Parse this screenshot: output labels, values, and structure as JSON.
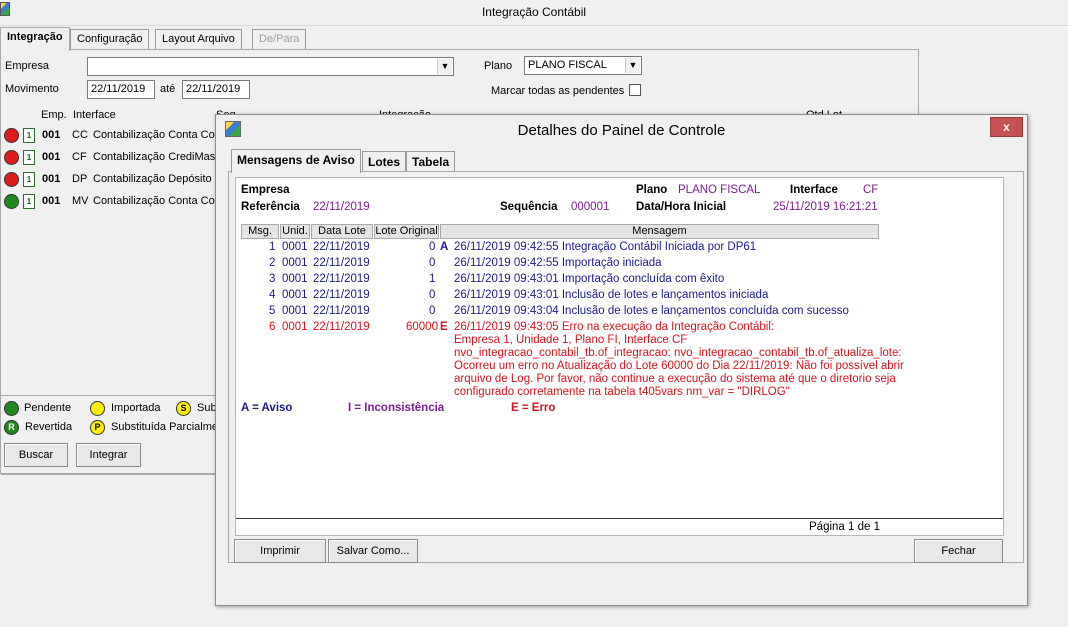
{
  "window": {
    "title": "Integração Contábil"
  },
  "tabs": [
    {
      "label": "Integração"
    },
    {
      "label": "Configuração"
    },
    {
      "label": "Layout Arquivo"
    },
    {
      "label": "De/Para"
    }
  ],
  "filters": {
    "empresa_label": "Empresa",
    "empresa_value": "",
    "movimento_label": "Movimento",
    "movimento_from": "22/11/2019",
    "ate_label": "até",
    "movimento_to": "22/11/2019",
    "plano_label": "Plano",
    "plano_value": "PLANO FISCAL",
    "marcar_label": "Marcar todas as pendentes"
  },
  "list": {
    "headers": {
      "emp": "Emp.",
      "interface": "Interface",
      "seq": "Seq",
      "integracao": "Integração",
      "qtd": "Qtd.Lot"
    },
    "rows": [
      {
        "status": "red",
        "emp": "001",
        "code": "CC",
        "desc": "Contabilização Conta Co",
        "status_color": "#e11b1b"
      },
      {
        "status": "red",
        "emp": "001",
        "code": "CF",
        "desc": "Contabilização CrediMasl",
        "status_color": "#e11b1b"
      },
      {
        "status": "red",
        "emp": "001",
        "code": "DP",
        "desc": "Contabilização Depósito",
        "status_color": "#e11b1b"
      },
      {
        "status": "green",
        "emp": "001",
        "code": "MV",
        "desc": "Contabilização Conta Co",
        "status_color": "#1e8a1e"
      }
    ]
  },
  "legend": {
    "pendente": "Pendente",
    "importada": "Importada",
    "sub": "Sub",
    "revertida": "Revertida",
    "substituida": "Substituída Parcialme",
    "r_letter": "R",
    "s_letter": "S",
    "p_letter": "P"
  },
  "buttons": {
    "buscar": "Buscar",
    "integrar": "Integrar"
  },
  "dialog": {
    "title": "Detalhes do Painel de Controle",
    "close": "x",
    "tabs": [
      "Mensagens de Aviso",
      "Lotes",
      "Tabela"
    ],
    "report": {
      "empresa_label": "Empresa",
      "referencia_label": "Referência",
      "referencia_value": "22/11/2019",
      "plano_label": "Plano",
      "plano_value": "PLANO FISCAL",
      "interface_label": "Interface",
      "interface_value": "CF",
      "sequencia_label": "Sequência",
      "sequencia_value": "000001",
      "datahora_label": "Data/Hora Inicial",
      "datahora_value": "25/11/2019 16:21:21",
      "columns": [
        "Msg.",
        "Unid.",
        "Data Lote",
        "Lote Original",
        "Mensagem"
      ],
      "messages": [
        {
          "n": "1",
          "unid": "0001",
          "data": "22/11/2019",
          "lote": "0",
          "type": "A",
          "lines": [
            "26/11/2019 09:42:55 Integração Contábil Iniciada por DP61"
          ]
        },
        {
          "n": "2",
          "unid": "0001",
          "data": "22/11/2019",
          "lote": "0",
          "type": "",
          "lines": [
            "26/11/2019 09:42:55 Importação iniciada"
          ]
        },
        {
          "n": "3",
          "unid": "0001",
          "data": "22/11/2019",
          "lote": "1",
          "type": "",
          "lines": [
            "26/11/2019 09:43:01 Importação concluída com êxito"
          ]
        },
        {
          "n": "4",
          "unid": "0001",
          "data": "22/11/2019",
          "lote": "0",
          "type": "",
          "lines": [
            "26/11/2019 09:43:01 Inclusão de lotes e lançamentos iniciada"
          ]
        },
        {
          "n": "5",
          "unid": "0001",
          "data": "22/11/2019",
          "lote": "0",
          "type": "",
          "lines": [
            "26/11/2019 09:43:04 Inclusão de lotes e lançamentos concluída com sucesso"
          ]
        },
        {
          "n": "6",
          "unid": "0001",
          "data": "22/11/2019",
          "lote": "60000",
          "type": "E",
          "lines": [
            "26/11/2019 09:43:05 Erro na execução da Integração Contábil:",
            "Empresa 1, Unidade 1, Plano FI, Interface CF",
            "nvo_integracao_contabil_tb.of_integracao: nvo_integracao_contabil_tb.of_atualiza_lote:",
            "Ocorreu um erro no Atualização do Lote 60000 do Dia 22/11/2019: Não foi possível abrir",
            "arquivo de Log. Por favor, não continue a execução do sistema até que o diretorio seja",
            "configurado corretamente na tabela t405vars nm_var = \"DIRLOG\""
          ]
        }
      ],
      "legend": {
        "a": "A = Aviso",
        "i": "I = Inconsistência",
        "e": "E = Erro"
      },
      "page": "Página 1 de 1"
    },
    "buttons": {
      "imprimir": "Imprimir",
      "salvar": "Salvar Como...",
      "fechar": "Fechar"
    }
  }
}
